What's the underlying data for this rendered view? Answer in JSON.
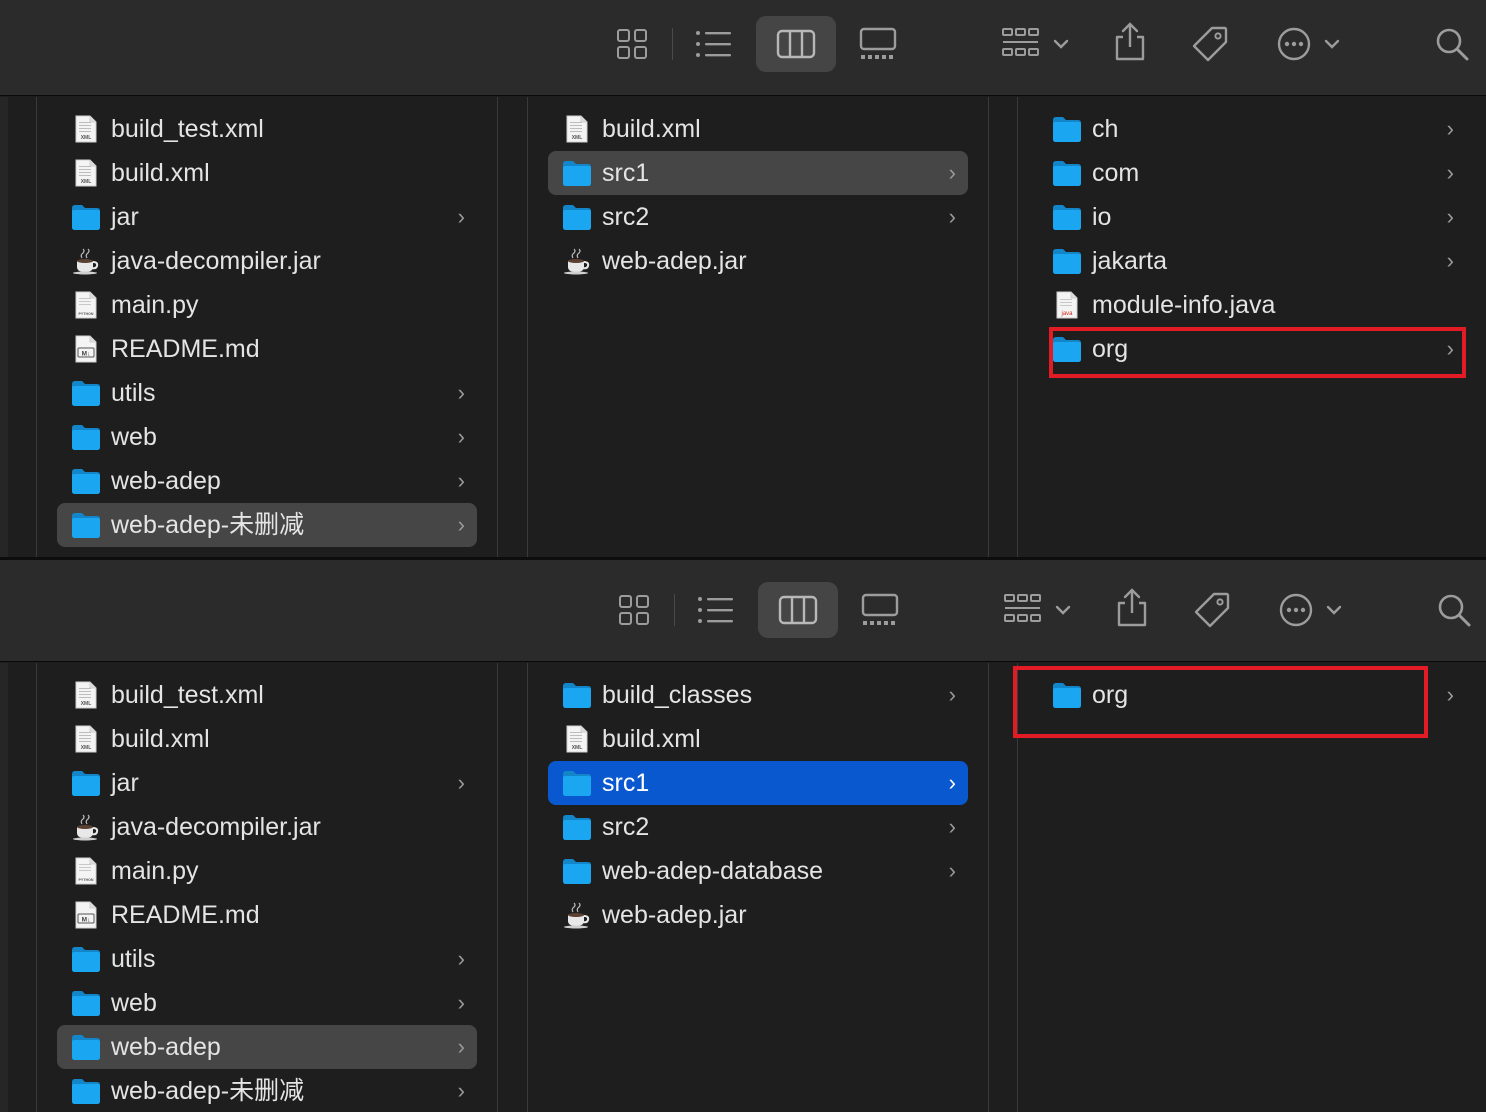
{
  "window_top": {
    "col1": [
      {
        "label": "build_test.xml",
        "icon": "xml-file-icon",
        "folder": false
      },
      {
        "label": "build.xml",
        "icon": "xml-file-icon",
        "folder": false
      },
      {
        "label": "jar",
        "icon": "folder-icon",
        "folder": true
      },
      {
        "label": "java-decompiler.jar",
        "icon": "jar-file-icon",
        "folder": false
      },
      {
        "label": "main.py",
        "icon": "python-file-icon",
        "folder": false
      },
      {
        "label": "README.md",
        "icon": "markdown-file-icon",
        "folder": false
      },
      {
        "label": "utils",
        "icon": "folder-icon",
        "folder": true
      },
      {
        "label": "web",
        "icon": "folder-icon",
        "folder": true
      },
      {
        "label": "web-adep",
        "icon": "folder-icon",
        "folder": true
      },
      {
        "label": "web-adep-未删减",
        "icon": "folder-icon",
        "folder": true,
        "selected": "gray"
      }
    ],
    "col2": [
      {
        "label": "build.xml",
        "icon": "xml-file-icon",
        "folder": false
      },
      {
        "label": "src1",
        "icon": "folder-icon",
        "folder": true,
        "selected": "gray"
      },
      {
        "label": "src2",
        "icon": "folder-icon",
        "folder": true
      },
      {
        "label": "web-adep.jar",
        "icon": "jar-file-icon",
        "folder": false
      }
    ],
    "col3": [
      {
        "label": "ch",
        "icon": "folder-icon",
        "folder": true
      },
      {
        "label": "com",
        "icon": "folder-icon",
        "folder": true
      },
      {
        "label": "io",
        "icon": "folder-icon",
        "folder": true
      },
      {
        "label": "jakarta",
        "icon": "folder-icon",
        "folder": true
      },
      {
        "label": "module-info.java",
        "icon": "java-file-icon",
        "folder": false
      },
      {
        "label": "org",
        "icon": "folder-icon",
        "folder": true
      }
    ]
  },
  "window_bottom": {
    "col1": [
      {
        "label": "build_test.xml",
        "icon": "xml-file-icon",
        "folder": false
      },
      {
        "label": "build.xml",
        "icon": "xml-file-icon",
        "folder": false
      },
      {
        "label": "jar",
        "icon": "folder-icon",
        "folder": true
      },
      {
        "label": "java-decompiler.jar",
        "icon": "jar-file-icon",
        "folder": false
      },
      {
        "label": "main.py",
        "icon": "python-file-icon",
        "folder": false
      },
      {
        "label": "README.md",
        "icon": "markdown-file-icon",
        "folder": false
      },
      {
        "label": "utils",
        "icon": "folder-icon",
        "folder": true
      },
      {
        "label": "web",
        "icon": "folder-icon",
        "folder": true
      },
      {
        "label": "web-adep",
        "icon": "folder-icon",
        "folder": true,
        "selected": "gray"
      },
      {
        "label": "web-adep-未删减",
        "icon": "folder-icon",
        "folder": true
      }
    ],
    "col2": [
      {
        "label": "build_classes",
        "icon": "folder-icon",
        "folder": true
      },
      {
        "label": "build.xml",
        "icon": "xml-file-icon",
        "folder": false
      },
      {
        "label": "src1",
        "icon": "folder-icon",
        "folder": true,
        "selected": "blue"
      },
      {
        "label": "src2",
        "icon": "folder-icon",
        "folder": true
      },
      {
        "label": "web-adep-database",
        "icon": "folder-icon",
        "folder": true
      },
      {
        "label": "web-adep.jar",
        "icon": "jar-file-icon",
        "folder": false
      }
    ],
    "col3": [
      {
        "label": "org",
        "icon": "folder-icon",
        "folder": true
      }
    ]
  },
  "glyphs": {
    "chevron": "›",
    "chevron_down": "⌄"
  },
  "icon_text": {
    "xml": "XML",
    "java": "java",
    "md": "M↓",
    "py": "PYTHON"
  },
  "colors": {
    "folder": "#1aa6f0",
    "highlight": "#e21b25",
    "selection_blue": "#0a58d0",
    "selection_gray": "#464646"
  }
}
